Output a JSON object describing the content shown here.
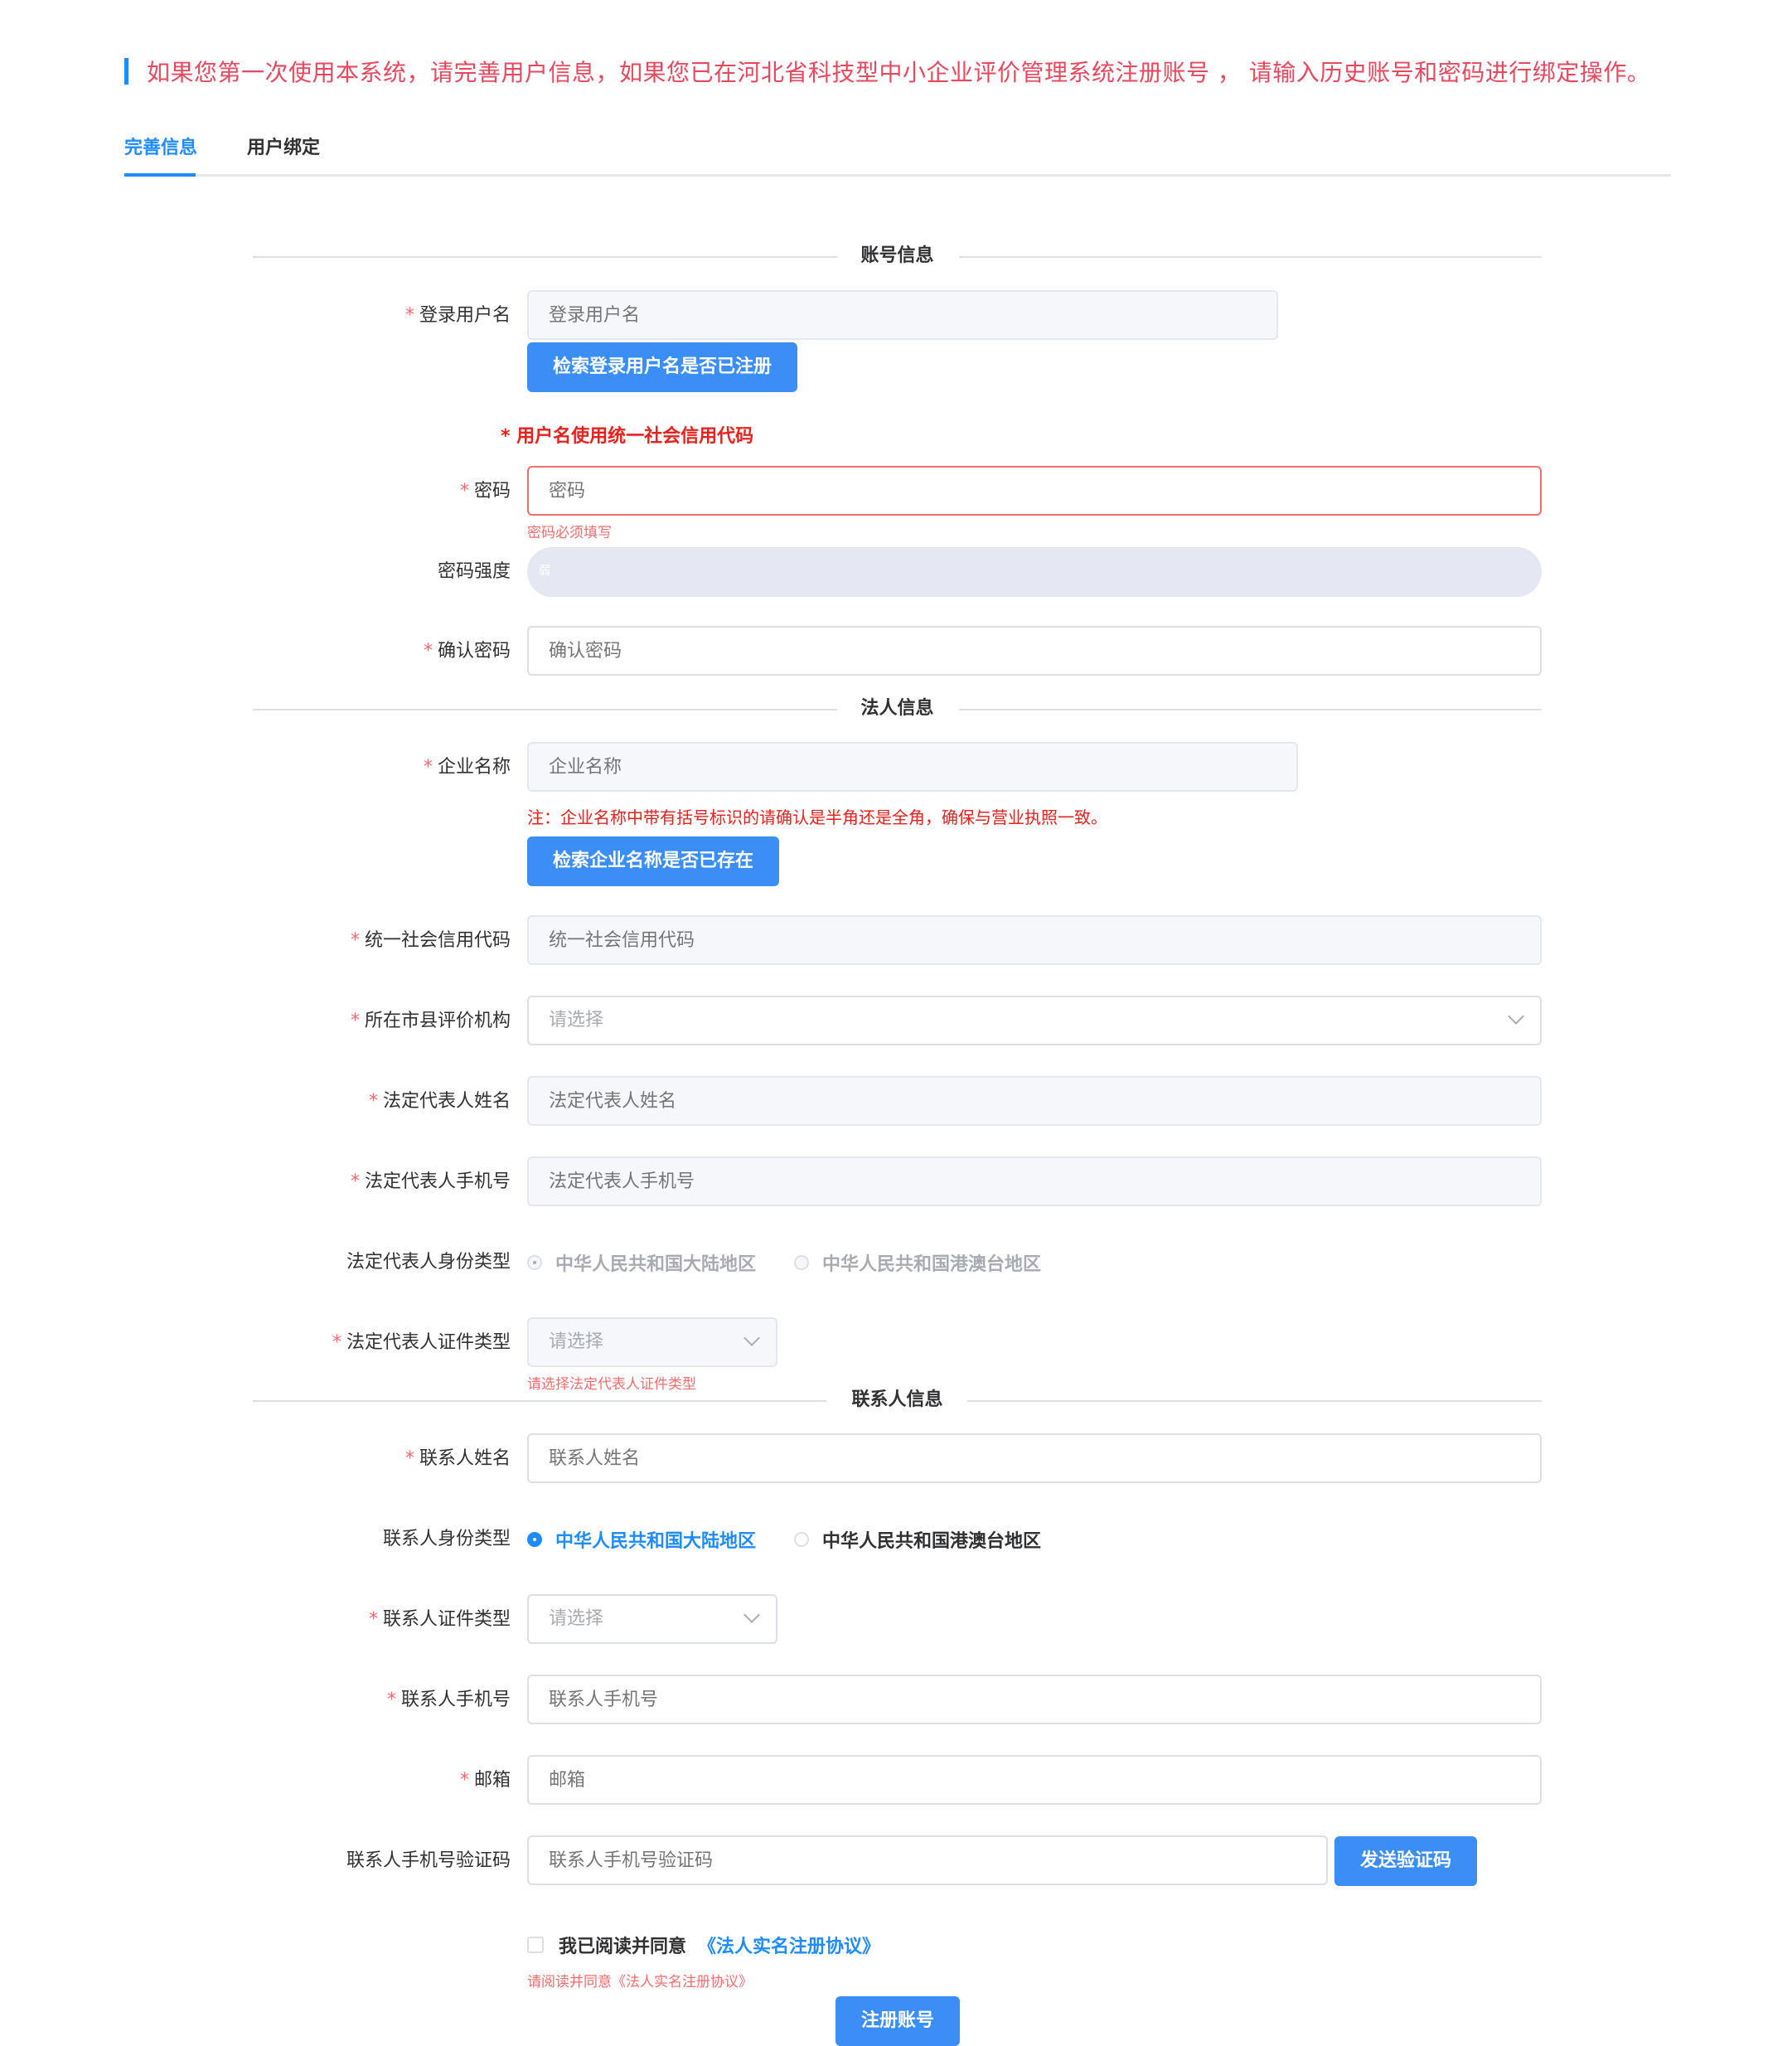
{
  "notice": "如果您第一次使用本系统，请完善用户信息，如果您已在河北省科技型中小企业评价管理系统注册账号 ， 请输入历史账号和密码进行绑定操作。",
  "tabs": [
    "完善信息",
    "用户绑定"
  ],
  "sections": {
    "account": "账号信息",
    "legal": "法人信息",
    "contact": "联系人信息"
  },
  "fields": {
    "username": {
      "label": "登录用户名",
      "placeholder": "登录用户名"
    },
    "check_username_btn": "检索登录用户名是否已注册",
    "username_note": "* 用户名使用统一社会信用代码",
    "password": {
      "label": "密码",
      "placeholder": "密码",
      "error": "密码必须填写"
    },
    "strength": {
      "label": "密码强度",
      "level": "弱"
    },
    "confirm_password": {
      "label": "确认密码",
      "placeholder": "确认密码"
    },
    "company": {
      "label": "企业名称",
      "placeholder": "企业名称",
      "note": "注：企业名称中带有括号标识的请确认是半角还是全角，确保与营业执照一致。"
    },
    "check_company_btn": "检索企业名称是否已存在",
    "credit_code": {
      "label": "统一社会信用代码",
      "placeholder": "统一社会信用代码"
    },
    "org": {
      "label": "所在市县评价机构",
      "placeholder": "请选择"
    },
    "legal_name": {
      "label": "法定代表人姓名",
      "placeholder": "法定代表人姓名"
    },
    "legal_phone": {
      "label": "法定代表人手机号",
      "placeholder": "法定代表人手机号"
    },
    "legal_id_type": {
      "label": "法定代表人身份类型",
      "options": [
        "中华人民共和国大陆地区",
        "中华人民共和国港澳台地区"
      ],
      "selected": 0
    },
    "legal_cert_type": {
      "label": "法定代表人证件类型",
      "placeholder": "请选择",
      "error": "请选择法定代表人证件类型"
    },
    "contact_name": {
      "label": "联系人姓名",
      "placeholder": "联系人姓名"
    },
    "contact_id_type": {
      "label": "联系人身份类型",
      "options": [
        "中华人民共和国大陆地区",
        "中华人民共和国港澳台地区"
      ],
      "selected": 0
    },
    "contact_cert_type": {
      "label": "联系人证件类型",
      "placeholder": "请选择"
    },
    "contact_phone": {
      "label": "联系人手机号",
      "placeholder": "联系人手机号"
    },
    "email": {
      "label": "邮箱",
      "placeholder": "邮箱"
    },
    "sms_code": {
      "label": "联系人手机号验证码",
      "placeholder": "联系人手机号验证码",
      "button": "发送验证码"
    }
  },
  "agreement": {
    "text": "我已阅读并同意",
    "link": "《法人实名注册协议》",
    "error": "请阅读并同意《法人实名注册协议》"
  },
  "submit": "注册账号",
  "colors": {
    "primary": "#3a8ef6",
    "error": "#f56c6c",
    "notice": "#e8485e"
  }
}
